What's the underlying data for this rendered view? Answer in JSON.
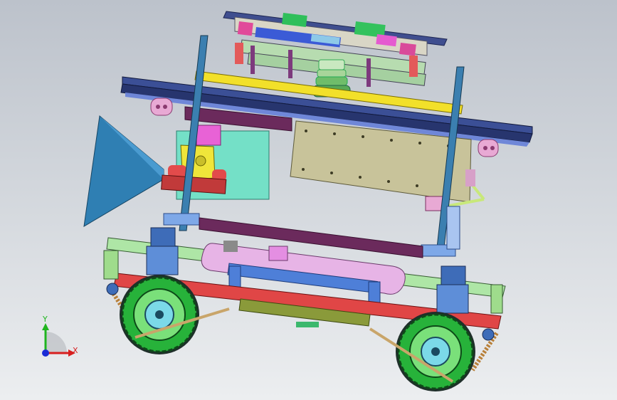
{
  "viewport": {
    "background_top": "#bcc2cb",
    "background_bottom": "#eceef0"
  },
  "triad": {
    "y_label": "Y",
    "x_label": "X",
    "y_color": "#1fb51f",
    "x_color": "#d71f1f",
    "z_color": "#1a2bd6"
  },
  "model": {
    "subject": "cad-assembly-wheeled-robot",
    "colors": {
      "frame_red": "#e04646",
      "frame_green": "#9fdc8c",
      "mast_blue": "#3b7fb0",
      "deck_navy": "#2c3d78",
      "yellow_rail": "#f2e02a",
      "cone_blue": "#2f7fb3",
      "tank_pink": "#e7b4e6",
      "panel_khaki": "#c8c39a",
      "mint_panel": "#74e0c7",
      "wheel_green": "#27b23a",
      "hub_cyan": "#7bd9e8",
      "purple_rod": "#6b2a5c"
    }
  }
}
